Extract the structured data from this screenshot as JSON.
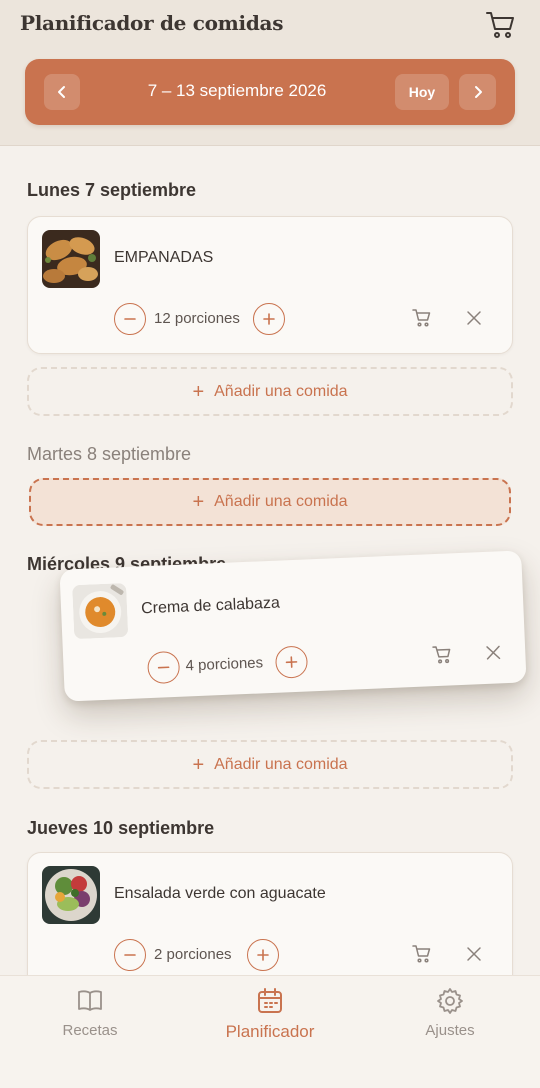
{
  "header": {
    "title": "Planificador de comidas",
    "week_label": "7 – 13 septiembre 2026",
    "today_label": "Hoy"
  },
  "colors": {
    "accent": "#c9734f",
    "background": "#f5f1ec",
    "header_bg": "#ece5dc"
  },
  "days": [
    {
      "title": "Lunes 7 septiembre",
      "meals": [
        {
          "name": "EMPANADAS",
          "portions": "12 porciones",
          "image": "empanadas-photo"
        }
      ],
      "add_label": "Añadir una comida"
    },
    {
      "title": "Martes 8 septiembre",
      "meals": [],
      "add_label": "Añadir una comida"
    },
    {
      "title": "Miércoles 9 septiembre",
      "meals": [],
      "add_label": "Añadir una comida"
    },
    {
      "title": "Jueves 10 septiembre",
      "meals": [
        {
          "name": "Ensalada verde con aguacate",
          "portions": "2 porciones",
          "image": "salad-photo"
        }
      ]
    }
  ],
  "dragging": {
    "name": "Crema de calabaza",
    "portions": "4 porciones",
    "image": "soup-photo"
  },
  "tabs": [
    {
      "label": "Recetas",
      "icon": "book-icon"
    },
    {
      "label": "Planificador",
      "icon": "calendar-icon",
      "active": true
    },
    {
      "label": "Ajustes",
      "icon": "gear-icon"
    }
  ]
}
